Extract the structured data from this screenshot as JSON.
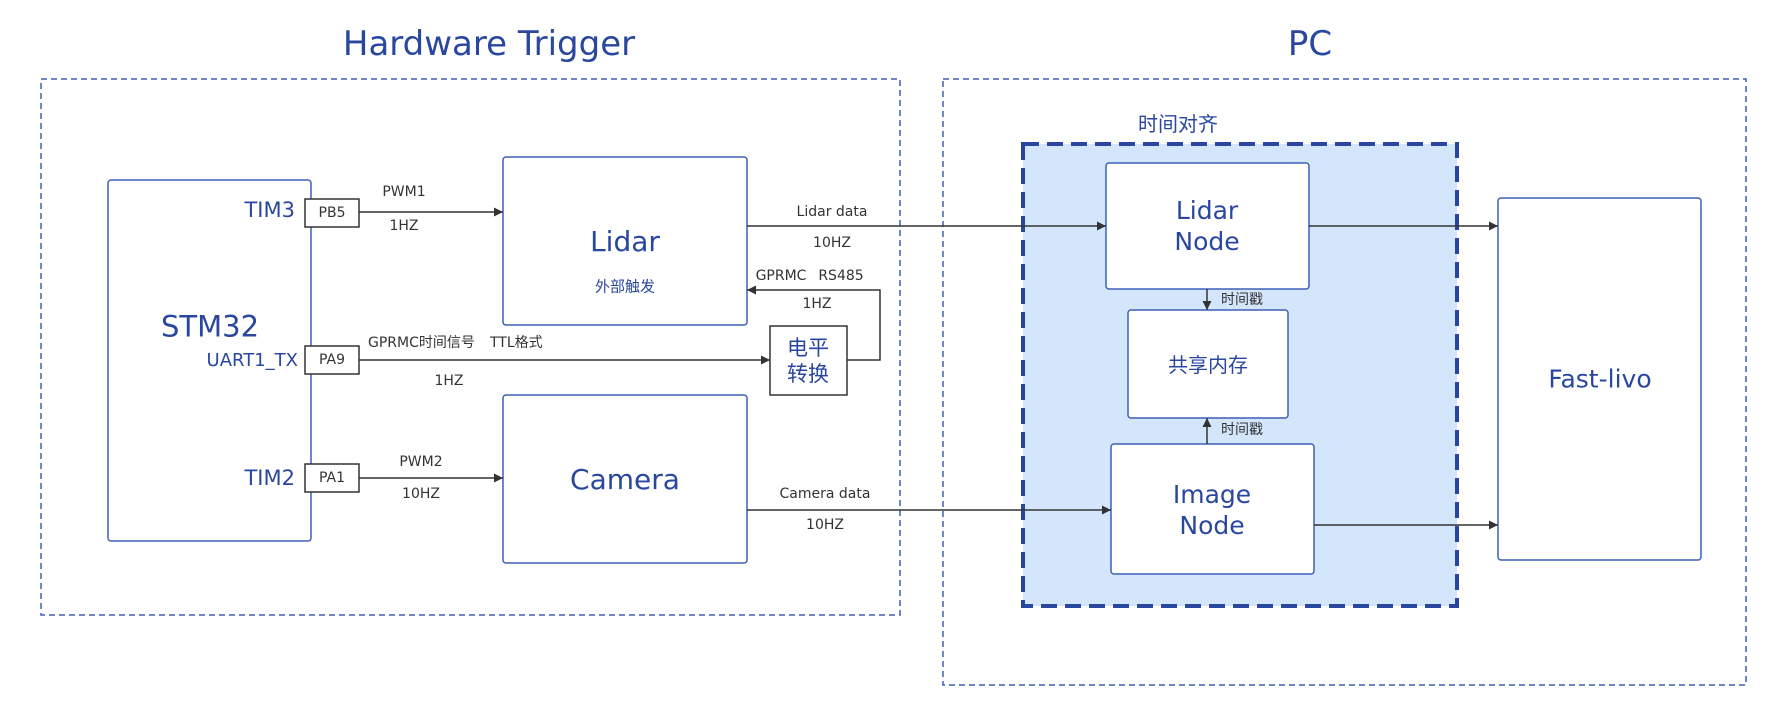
{
  "sections": {
    "hardware_title": "Hardware Trigger",
    "pc_title": "PC",
    "sync_group_label": "时间对齐"
  },
  "stm32": {
    "label": "STM32",
    "tim3": "TIM3",
    "uart": "UART1_TX",
    "tim2": "TIM2",
    "pin_pb5": "PB5",
    "pin_pa9": "PA9",
    "pin_pa1": "PA1"
  },
  "lidar": {
    "label": "Lidar",
    "sublabel": "外部触发"
  },
  "camera": {
    "label": "Camera"
  },
  "level_shift": {
    "line1": "电平",
    "line2": "转换"
  },
  "nodes": {
    "lidar_node_line1": "Lidar",
    "lidar_node_line2": "Node",
    "shared_memory": "共享内存",
    "image_node_line1": "Image",
    "image_node_line2": "Node",
    "fast_livo": "Fast-livo"
  },
  "edges": {
    "pwm1": "PWM1",
    "pwm1_freq": "1HZ",
    "gprmc_signal": "GPRMC时间信号",
    "ttl_format": "TTL格式",
    "gprmc_freq": "1HZ",
    "pwm2": "PWM2",
    "pwm2_freq": "10HZ",
    "lidar_data": "Lidar data",
    "lidar_data_freq": "10HZ",
    "gprmc": "GPRMC",
    "rs485": "RS485",
    "rs485_freq": "1HZ",
    "camera_data": "Camera data",
    "camera_data_freq": "10HZ",
    "timestamp_top": "时间戳",
    "timestamp_bottom": "时间戳"
  },
  "colors": {
    "accent": "#2a47a0",
    "box_border": "#3f5fb8",
    "sync_fill": "#d4e6fc",
    "line": "#333333"
  }
}
